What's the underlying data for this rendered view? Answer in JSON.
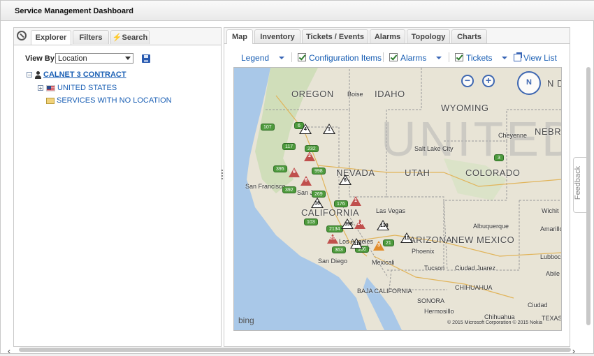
{
  "window": {
    "title": "Service Management Dashboard"
  },
  "left_panel": {
    "tabs": [
      "Explorer",
      "Filters",
      "Search"
    ],
    "active_tab": "Explorer",
    "view_by_label": "View By",
    "view_by_value": "Location",
    "tree": {
      "root": "CALNET 3 CONTRACT",
      "children": [
        "UNITED STATES",
        "SERVICES WITH NO LOCATION"
      ]
    }
  },
  "right_panel": {
    "tabs": [
      "Map",
      "Inventory",
      "Tickets / Events",
      "Alarms",
      "Topology",
      "Charts"
    ],
    "active_tab": "Map",
    "toolbar": {
      "legend": "Legend",
      "config_items": "Configuration Items",
      "alarms": "Alarms",
      "tickets": "Tickets",
      "view_list": "View List"
    }
  },
  "map": {
    "watermark": "UNITED",
    "states": [
      "OREGON",
      "IDAHO",
      "WYOMING",
      "NEVADA",
      "UTAH",
      "COLORADO",
      "CALIFORNIA",
      "ARIZONA",
      "NEW MEXICO",
      "NEBRA",
      "N DA"
    ],
    "cities": [
      "Boise",
      "Cheyenne",
      "Salt Lake City",
      "San Francisco",
      "San Jo",
      "Las Vegas",
      "Albuquerque",
      "Los Angeles",
      "Phoenix",
      "San Diego",
      "Mexicali",
      "Tucson",
      "Ciudad Juarez",
      "CHIHUAHUA",
      "BAJA CALIFORNIA",
      "SONORA",
      "Hermosillo",
      "Chihuahua",
      "Ciudad",
      "Lubbock",
      "Amarillo",
      "Abile",
      "Wichit",
      "TEXAS"
    ],
    "zoom_out": "−",
    "zoom_in": "+",
    "compass": "N",
    "bing": "bing",
    "copyright": "© 2015 Microsoft Corporation   © 2015 Nokia",
    "green_badges": [
      "107",
      "117",
      "232",
      "395",
      "998",
      "392",
      "269",
      "176",
      "103",
      "2134",
      "363",
      "106",
      "21",
      "3",
      "6"
    ],
    "red_alerts": [
      "2",
      "6",
      "6",
      "1",
      "14",
      "20"
    ],
    "orange_alerts": [
      "3"
    ],
    "white_alerts": [
      "4",
      "1",
      "6",
      "16",
      "398",
      "118",
      "138",
      "11"
    ]
  },
  "side": {
    "feedback": "Feedback"
  },
  "colors": {
    "accent": "#1a5fb4",
    "green_badge": "#4d9a3c",
    "red_alert": "#c0504d",
    "orange_alert": "#e28c2a"
  }
}
